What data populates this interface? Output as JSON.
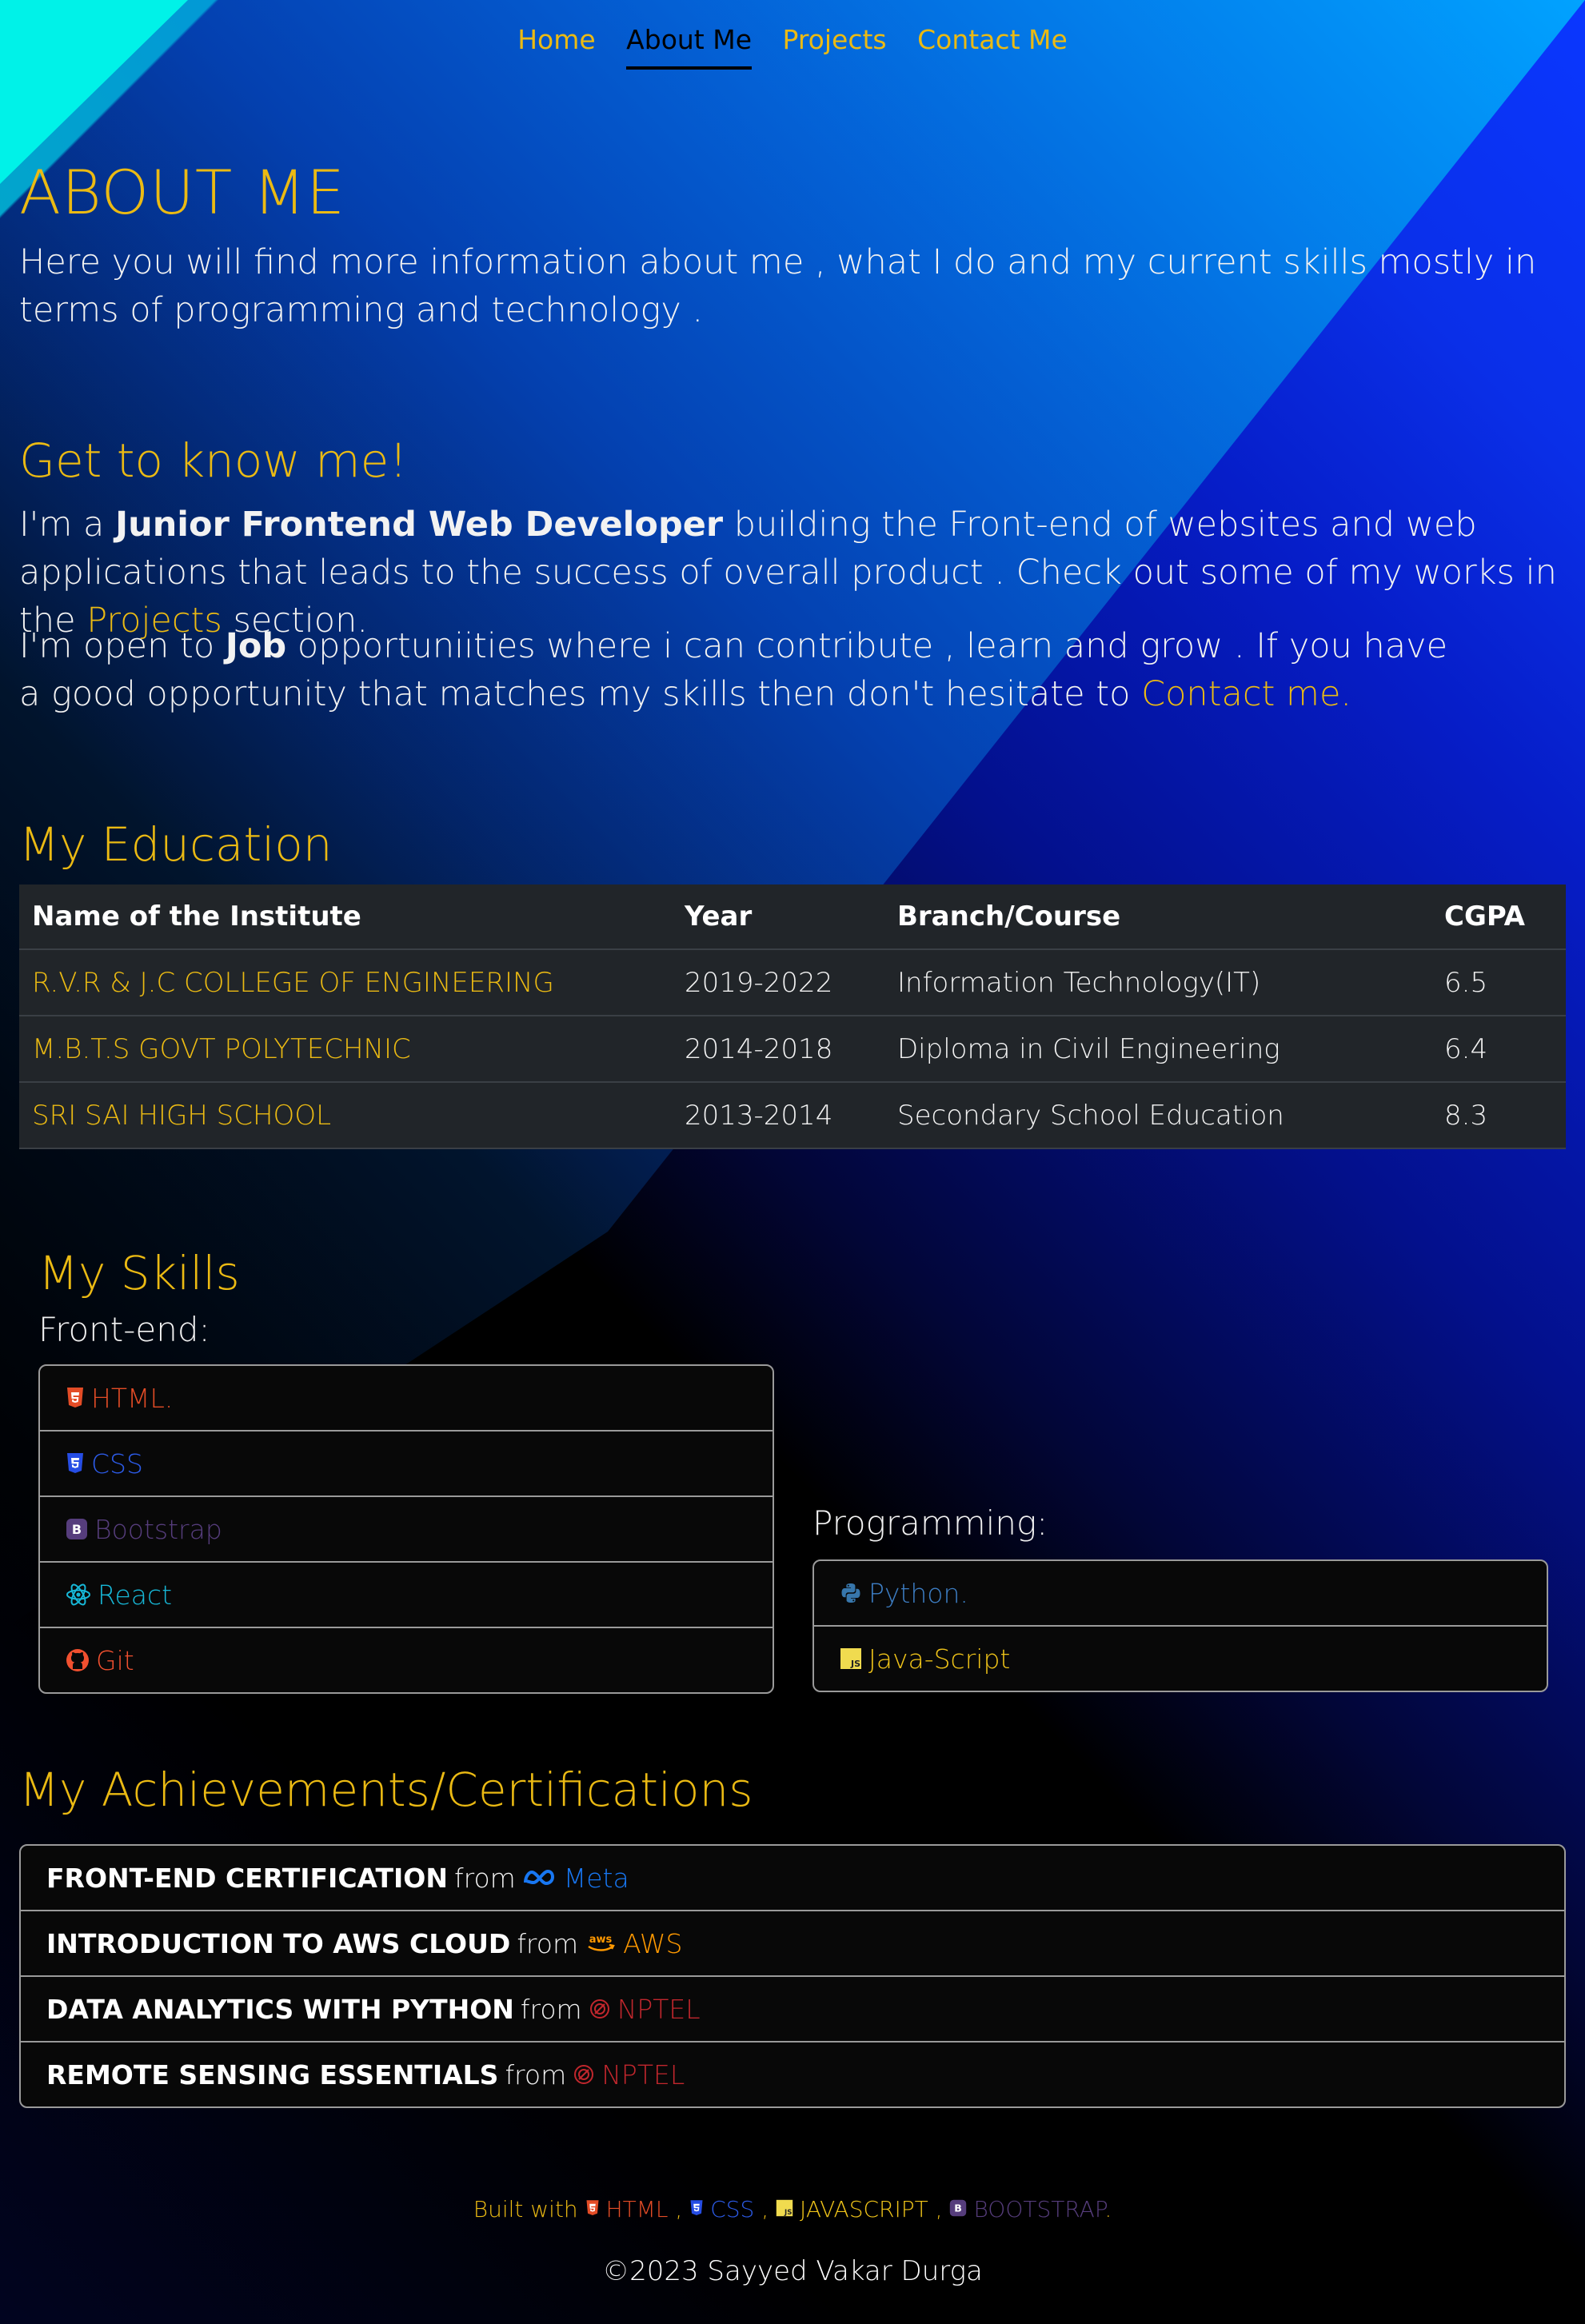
{
  "nav": {
    "items": [
      "Home",
      "About Me",
      "Projects",
      "Contact Me"
    ]
  },
  "about": {
    "title": "ABOUT ME",
    "intro": "Here you will find more information about me , what I do and my current skills mostly in terms of programming and technology ."
  },
  "know": {
    "title": "Get to know me!",
    "p1_a": "I'm a ",
    "p1_b": "Junior Frontend Web Developer",
    "p1_c": " building the Front-end of websites and web applications that leads to the success of overall product . Check out some of my works in the ",
    "p1_link": "Projects",
    "p1_d": " section.",
    "p2_a": "I'm open to ",
    "p2_b": "Job",
    "p2_c": " opportuniities where i can contribute , learn and grow . If you have a good opportunity that matches my skills then don't hesitate to ",
    "p2_link": "Contact me."
  },
  "education": {
    "title": "My Education",
    "headers": [
      "Name of the Institute",
      "Year",
      "Branch/Course",
      "CGPA"
    ],
    "rows": [
      [
        "R.V.R & J.C COLLEGE OF ENGINEERING",
        "2019-2022",
        "Information Technology(IT)",
        "6.5"
      ],
      [
        "M.B.T.S GOVT POLYTECHNIC",
        "2014-2018",
        "Diploma in Civil Engineering",
        "6.4"
      ],
      [
        "SRI SAI HIGH SCHOOL",
        "2013-2014",
        "Secondary School Education",
        "8.3"
      ]
    ]
  },
  "skills": {
    "title": "My Skills",
    "frontend_label": "Front-end:",
    "frontend": [
      {
        "label": "HTML.",
        "icon": "html5-icon",
        "color": "#e34c26"
      },
      {
        "label": "CSS",
        "icon": "css3-icon",
        "color": "#264de4"
      },
      {
        "label": "Bootstrap",
        "icon": "bootstrap-icon",
        "color": "#563d7c"
      },
      {
        "label": "React",
        "icon": "react-icon",
        "color": "#17b8d8"
      },
      {
        "label": "Git",
        "icon": "github-icon",
        "color": "#f1502f"
      }
    ],
    "programming_label": "Programming:",
    "programming": [
      {
        "label": "Python.",
        "icon": "python-icon",
        "color": "#3776ab"
      },
      {
        "label": "Java-Script",
        "icon": "javascript-icon",
        "color": "#f0db4f"
      }
    ]
  },
  "achievements": {
    "title": "My Achievements/Certifications",
    "items": [
      {
        "name": "FRONT-END CERTIFICATION",
        "from": "from",
        "org": "Meta",
        "icon": "meta-icon",
        "color": "#1877f2"
      },
      {
        "name": "INTRODUCTION TO AWS CLOUD",
        "from": "from",
        "org": "AWS",
        "icon": "aws-icon",
        "color": "#ff9900"
      },
      {
        "name": "DATA ANALYTICS WITH PYTHON",
        "from": "from",
        "org": "NPTEL",
        "icon": "nptel-icon",
        "color": "#c1272d"
      },
      {
        "name": "REMOTE SENSING ESSENTIALS",
        "from": "from",
        "org": "NPTEL",
        "icon": "nptel-icon",
        "color": "#c1272d"
      }
    ]
  },
  "footer": {
    "built_with": "Built with",
    "sep": ",",
    "techs": [
      {
        "label": "HTML",
        "icon": "html5-icon",
        "color": "#e34c26"
      },
      {
        "label": "CSS",
        "icon": "css3-icon",
        "color": "#264de4"
      },
      {
        "label": "JAVASCRIPT",
        "icon": "javascript-icon",
        "color": "#f0db4f"
      },
      {
        "label": "BOOTSTRAP",
        "icon": "bootstrap-icon",
        "color": "#563d7c"
      }
    ],
    "end": ".",
    "copyright": "©2023 Sayyed Vakar Durga"
  },
  "colors": {
    "accent": "#ebba13",
    "table_bg": "#212529"
  }
}
